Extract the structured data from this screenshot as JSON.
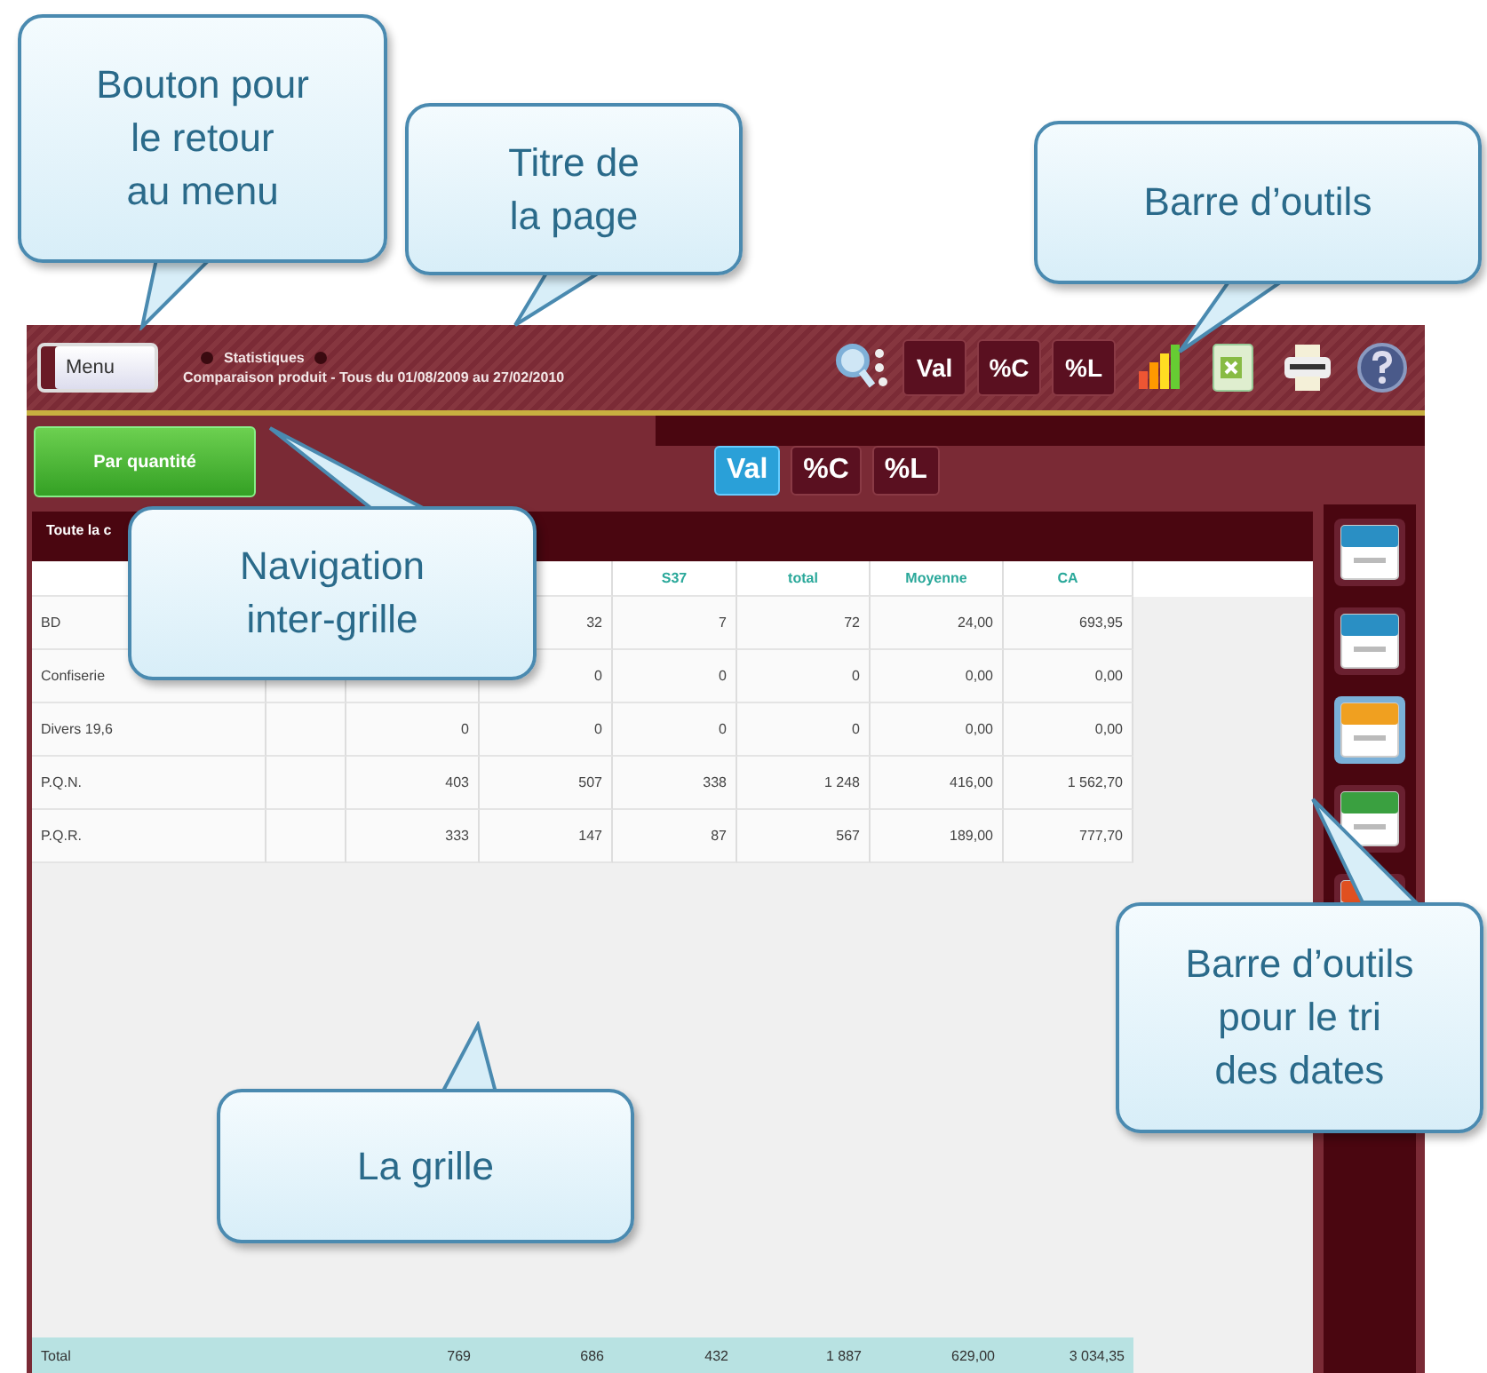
{
  "header": {
    "menu_button": "Menu",
    "breadcrumb": "Statistiques",
    "page_title": "Comparaison produit - Tous du 01/08/2009 au 27/02/2010",
    "toolbar": [
      {
        "kind": "search"
      },
      {
        "kind": "text",
        "label": "Val"
      },
      {
        "kind": "text",
        "label": "%C"
      },
      {
        "kind": "text",
        "label": "%L"
      },
      {
        "kind": "chart"
      },
      {
        "kind": "spreadsheet"
      },
      {
        "kind": "print"
      },
      {
        "kind": "help"
      }
    ]
  },
  "nav_button": "Par quantité",
  "view_toggles": [
    {
      "label": "Val",
      "selected": true
    },
    {
      "label": "%C",
      "selected": false
    },
    {
      "label": "%L",
      "selected": false
    }
  ],
  "grid": {
    "title": "Toute la c",
    "columns": [
      null,
      null,
      null,
      null,
      "S37",
      "total",
      "Moyenne",
      "CA"
    ],
    "rows": [
      [
        "BD",
        null,
        null,
        "32",
        "7",
        "72",
        "24,00",
        "693,95"
      ],
      [
        "Confiserie",
        null,
        null,
        "0",
        "0",
        "0",
        "0,00",
        "0,00"
      ],
      [
        "Divers 19,6",
        null,
        "0",
        "0",
        "0",
        "0",
        "0,00",
        "0,00"
      ],
      [
        "P.Q.N.",
        null,
        "403",
        "507",
        "338",
        "1 248",
        "416,00",
        "1 562,70"
      ],
      [
        "P.Q.R.",
        null,
        "333",
        "147",
        "87",
        "567",
        "189,00",
        "777,70"
      ]
    ],
    "total": {
      "label": "Total",
      "values": [
        "769",
        "686",
        "432",
        "1 887",
        "629,00",
        "3 034,35"
      ]
    }
  },
  "date_sort_buttons": [
    {
      "color": "#2a8fc4",
      "selected": false
    },
    {
      "color": "#2a8fc4",
      "selected": false
    },
    {
      "color": "#f0a020",
      "selected": true
    },
    {
      "color": "#3aa040",
      "selected": false
    },
    {
      "color": "#e05020",
      "selected": false
    }
  ],
  "callouts": [
    {
      "text": "Bouton pour\nle retour\nau menu"
    },
    {
      "text": "Titre de\nla page"
    },
    {
      "text": "Barre d’outils"
    },
    {
      "text": "Navigation\ninter-grille"
    },
    {
      "text": "Barre d’outils\npour le tri\ndes dates"
    },
    {
      "text": "La grille"
    }
  ]
}
